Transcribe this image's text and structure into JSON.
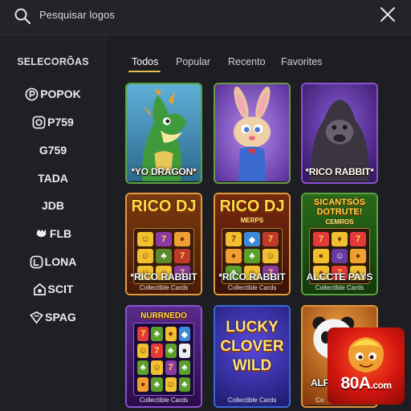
{
  "search": {
    "placeholder": "Pesquisar logos",
    "icon": "search-icon",
    "close_icon": "close-icon"
  },
  "sidebar": {
    "title": "SELECORÕAS",
    "providers": [
      {
        "label": "POPOK",
        "icon": "popok-logo-icon"
      },
      {
        "label": "P759",
        "icon": "p759-logo-icon"
      },
      {
        "label": "G759",
        "icon": ""
      },
      {
        "label": "TADA",
        "icon": ""
      },
      {
        "label": "JDB",
        "icon": ""
      },
      {
        "label": "FLB",
        "icon": "flb-logo-icon"
      },
      {
        "label": "LONA",
        "icon": "lona-logo-icon"
      },
      {
        "label": "SCIT",
        "icon": "scit-logo-icon"
      },
      {
        "label": "SPAG",
        "icon": "spag-logo-icon"
      }
    ]
  },
  "tabs": [
    {
      "label": "Todos",
      "active": true
    },
    {
      "label": "Popular",
      "active": false
    },
    {
      "label": "Recento",
      "active": false
    },
    {
      "label": "Favorites",
      "active": false
    }
  ],
  "games": [
    {
      "title": "*YO DRAGON*",
      "subtitle": "",
      "caption": "",
      "art": "green-dragon"
    },
    {
      "title": "",
      "subtitle": "",
      "caption": "",
      "art": "cartoon-rabbit"
    },
    {
      "title": "*RICO RABBIT*",
      "subtitle": "",
      "caption": "",
      "art": "gorilla"
    },
    {
      "title": "*RICO RABBIT",
      "top": "RICO DJ",
      "subtitle": "",
      "caption": "Collectible Cards",
      "art": "slot-reels"
    },
    {
      "title": "*RICO RABBIT",
      "top": "RICO DJ",
      "subtitle": "MERPS",
      "caption": "Collectible Cards",
      "art": "slot-reels"
    },
    {
      "title": "ALCCTE PAYS",
      "top": "SICANTSÓS DOTRUTE!",
      "subtitle": "CEMROS",
      "caption": "Collectible Cards",
      "art": "slot-reels"
    },
    {
      "title": "",
      "top": "NURRNEDO",
      "subtitle": "",
      "caption": "Collectible Cards",
      "art": "slot-reels"
    },
    {
      "title": "",
      "top": "LUCKY CLOVER WILD",
      "subtitle": "",
      "caption": "Collectible Cards",
      "art": "lucky-clover"
    },
    {
      "title": "ALP",
      "subtitle": "",
      "caption": "Co",
      "art": "panda"
    }
  ],
  "badge": {
    "text": "80A",
    "suffix": ".com"
  },
  "colors": {
    "background": "#1d1e22",
    "tab_underline": "#e8c04a",
    "card_border_green": "#4a8c3a",
    "card_border_orange": "#d8842a",
    "card_border_purple": "#8a4ad0"
  }
}
